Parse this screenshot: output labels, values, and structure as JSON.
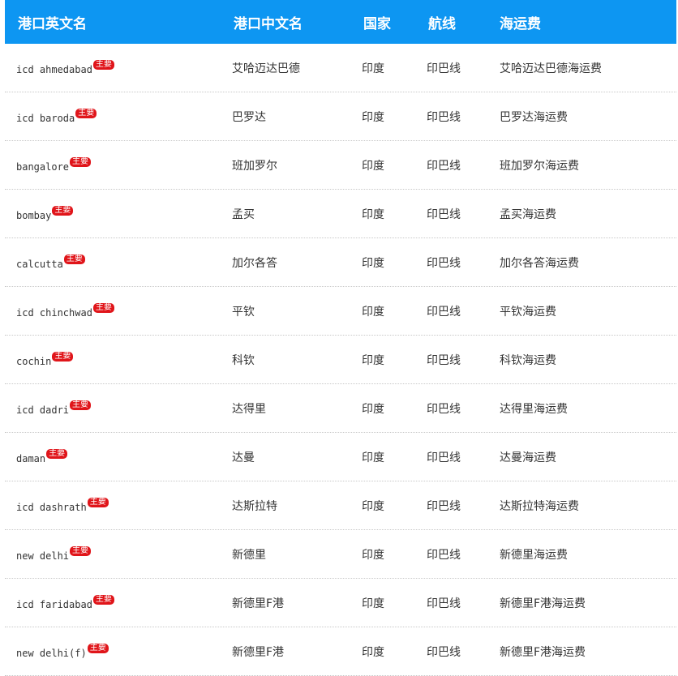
{
  "header": {
    "col_en": "港口英文名",
    "col_cn": "港口中文名",
    "col_country": "国家",
    "col_route": "航线",
    "col_freight": "海运费"
  },
  "badge_color": "#e0151a",
  "header_color": "#0d96f2",
  "rows": [
    {
      "en": "icd ahmedabad",
      "badge": "主要",
      "cn": "艾哈迈达巴德",
      "country": "印度",
      "route": "印巴线",
      "freight": "艾哈迈达巴德海运费"
    },
    {
      "en": "icd baroda",
      "badge": "主要",
      "cn": "巴罗达",
      "country": "印度",
      "route": "印巴线",
      "freight": "巴罗达海运费"
    },
    {
      "en": "bangalore",
      "badge": "主要",
      "cn": "班加罗尔",
      "country": "印度",
      "route": "印巴线",
      "freight": "班加罗尔海运费"
    },
    {
      "en": "bombay",
      "badge": "主要",
      "cn": "孟买",
      "country": "印度",
      "route": "印巴线",
      "freight": "孟买海运费"
    },
    {
      "en": "calcutta",
      "badge": "主要",
      "cn": "加尔各答",
      "country": "印度",
      "route": "印巴线",
      "freight": "加尔各答海运费"
    },
    {
      "en": "icd chinchwad",
      "badge": "主要",
      "cn": "平钦",
      "country": "印度",
      "route": "印巴线",
      "freight": "平钦海运费"
    },
    {
      "en": "cochin",
      "badge": "主要",
      "cn": "科钦",
      "country": "印度",
      "route": "印巴线",
      "freight": "科钦海运费"
    },
    {
      "en": "icd dadri",
      "badge": "主要",
      "cn": "达得里",
      "country": "印度",
      "route": "印巴线",
      "freight": "达得里海运费"
    },
    {
      "en": "daman",
      "badge": "主要",
      "cn": "达曼",
      "country": "印度",
      "route": "印巴线",
      "freight": "达曼海运费"
    },
    {
      "en": "icd dashrath",
      "badge": "主要",
      "cn": "达斯拉特",
      "country": "印度",
      "route": "印巴线",
      "freight": "达斯拉特海运费"
    },
    {
      "en": "new delhi",
      "badge": "主要",
      "cn": "新德里",
      "country": "印度",
      "route": "印巴线",
      "freight": "新德里海运费"
    },
    {
      "en": "icd faridabad",
      "badge": "主要",
      "cn": "新德里F港",
      "country": "印度",
      "route": "印巴线",
      "freight": "新德里F港海运费"
    },
    {
      "en": "new delhi(f)",
      "badge": "主要",
      "cn": "新德里F港",
      "country": "印度",
      "route": "印巴线",
      "freight": "新德里F港海运费"
    }
  ]
}
